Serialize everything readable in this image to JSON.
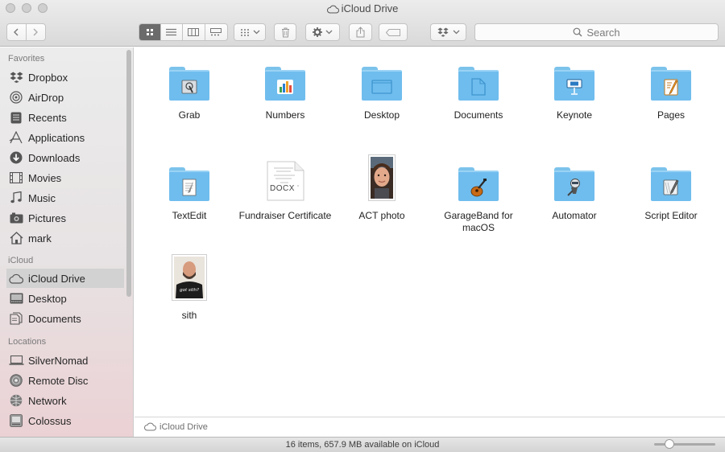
{
  "window": {
    "title": "iCloud Drive"
  },
  "toolbar": {
    "search_placeholder": "Search"
  },
  "sidebar": {
    "sections": [
      {
        "heading": "Favorites",
        "items": [
          {
            "label": "Dropbox",
            "icon": "dropbox-icon"
          },
          {
            "label": "AirDrop",
            "icon": "airdrop-icon"
          },
          {
            "label": "Recents",
            "icon": "recents-icon"
          },
          {
            "label": "Applications",
            "icon": "applications-icon"
          },
          {
            "label": "Downloads",
            "icon": "downloads-icon"
          },
          {
            "label": "Movies",
            "icon": "movies-icon"
          },
          {
            "label": "Music",
            "icon": "music-icon"
          },
          {
            "label": "Pictures",
            "icon": "pictures-icon"
          },
          {
            "label": "mark",
            "icon": "home-icon"
          }
        ]
      },
      {
        "heading": "iCloud",
        "items": [
          {
            "label": "iCloud Drive",
            "icon": "cloud-icon",
            "selected": true
          },
          {
            "label": "Desktop",
            "icon": "desktop-icon"
          },
          {
            "label": "Documents",
            "icon": "documents-icon"
          }
        ]
      },
      {
        "heading": "Locations",
        "items": [
          {
            "label": "SilverNomad",
            "icon": "laptop-icon"
          },
          {
            "label": "Remote Disc",
            "icon": "disc-icon"
          },
          {
            "label": "Network",
            "icon": "network-icon"
          },
          {
            "label": "Colossus",
            "icon": "drive-icon"
          }
        ]
      }
    ]
  },
  "files": [
    {
      "name": "Grab",
      "kind": "folder"
    },
    {
      "name": "Numbers",
      "kind": "folder"
    },
    {
      "name": "Desktop",
      "kind": "folder"
    },
    {
      "name": "Documents",
      "kind": "folder"
    },
    {
      "name": "Keynote",
      "kind": "folder"
    },
    {
      "name": "Pages",
      "kind": "folder"
    },
    {
      "name": "TextEdit",
      "kind": "folder"
    },
    {
      "name": "Fundraiser Certificate",
      "kind": "docx",
      "badge": "DOCX"
    },
    {
      "name": "ACT photo",
      "kind": "photo"
    },
    {
      "name": "GarageBand for macOS",
      "kind": "folder"
    },
    {
      "name": "Automator",
      "kind": "folder"
    },
    {
      "name": "Script Editor",
      "kind": "folder"
    },
    {
      "name": "sith",
      "kind": "photo",
      "shirt_text": "got sith?"
    }
  ],
  "pathbar": {
    "label": "iCloud Drive"
  },
  "status": {
    "text": "16 items, 657.9 MB available on iCloud"
  },
  "icon_size_slider": {
    "value": 0.2
  },
  "colors": {
    "folder": "#6fbdee",
    "selection": "#d2d2d2"
  }
}
